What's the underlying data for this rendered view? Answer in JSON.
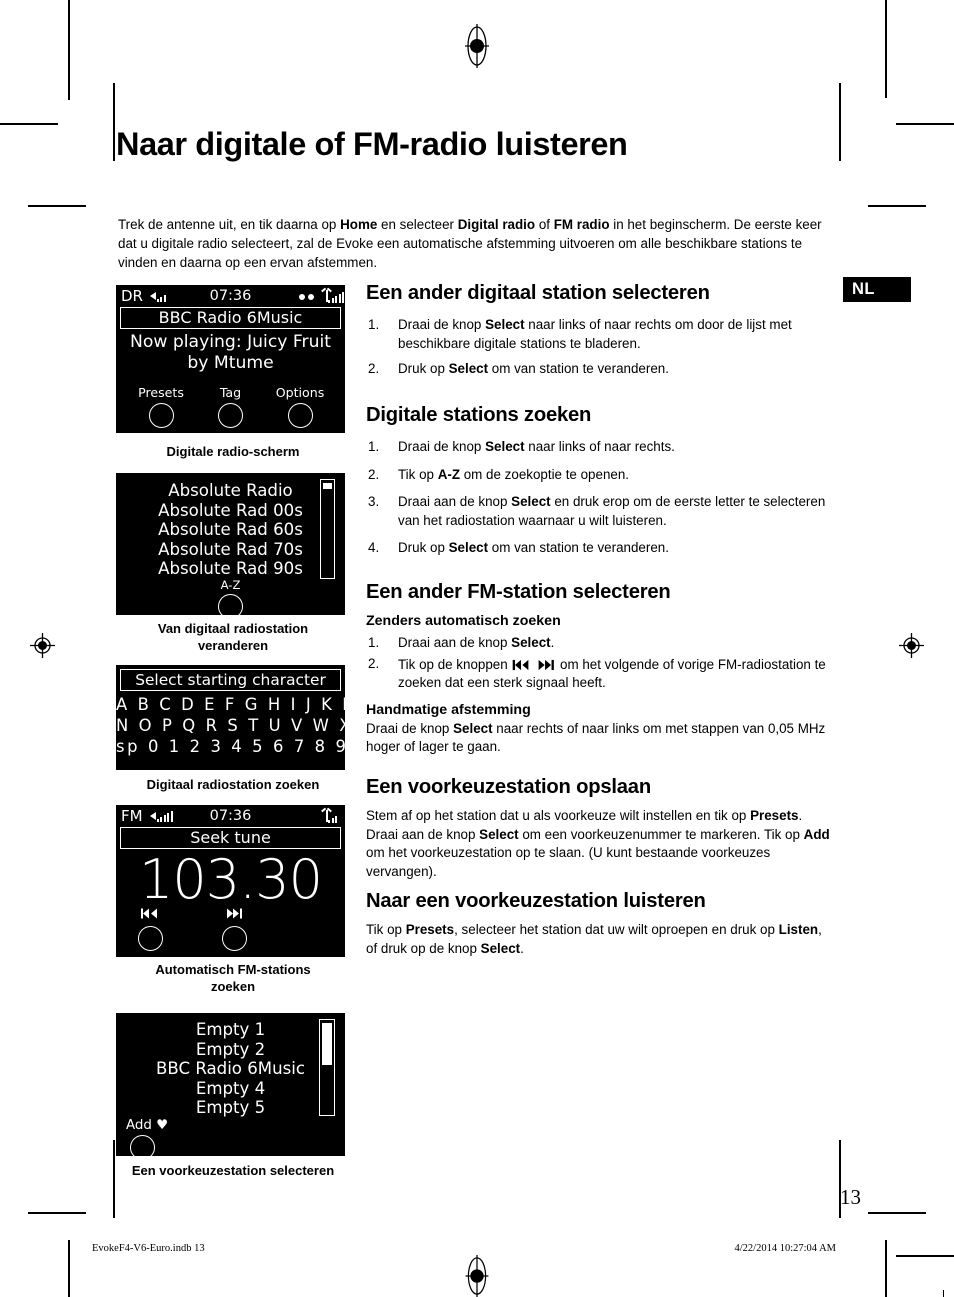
{
  "page": {
    "title": "Naar digitale of FM-radio luisteren",
    "language_badge": "NL",
    "folio": "13",
    "footer_left": "EvokeF4-V6-Euro.indb   13",
    "footer_right": "4/22/2014   10:27:04 AM"
  },
  "intro": {
    "part1": "Trek de antenne uit, en tik daarna op ",
    "b1": "Home",
    "part2": " en selecteer ",
    "b2": "Digital radio",
    "part3": " of ",
    "b3": "FM radio",
    "part4": " in het beginscherm. De eerste keer dat u digitale radio selecteert, zal de Evoke een automatische afstemming uitvoeren om alle beschikbare stations te vinden en daarna op een ervan afstemmen."
  },
  "screens": {
    "digital_radio": {
      "caption": "Digitale radio-scherm",
      "status": {
        "mode": "DR",
        "time": "07:36",
        "volume_icon": "volume-icon",
        "dots_icon": "stereo-dots-icon",
        "signal_icon": "antenna-signal-icon"
      },
      "station": "BBC Radio 6Music",
      "now_playing_line1": "Now playing: Juicy Fruit",
      "now_playing_line2": "by Mtume",
      "softkeys": [
        "Presets",
        "Tag",
        "Options"
      ]
    },
    "station_list": {
      "caption_line1": "Van digitaal radiostation",
      "caption_line2": "veranderen",
      "rows": [
        {
          "label": "Absolute Radio",
          "selected": false
        },
        {
          "label": "Absolute Rad 00s",
          "selected": false
        },
        {
          "label": "Absolute Rad 60s",
          "selected": true
        },
        {
          "label": "Absolute Rad 70s",
          "selected": false
        },
        {
          "label": "Absolute Rad 90s",
          "selected": false
        }
      ],
      "softkey": "A-Z"
    },
    "keyboard": {
      "caption": "Digitaal radiostation zoeken",
      "banner": "Select starting character",
      "rows": [
        "A B C D E F G H I J K L M",
        "N O P Q R S T U V W X Y Z",
        "sp 0 1 2 3 4 5 6 7 8 9"
      ]
    },
    "fm": {
      "caption_line1": "Automatisch FM-stations",
      "caption_line2": "zoeken",
      "status": {
        "mode": "FM",
        "time": "07:36"
      },
      "banner": "Seek tune",
      "frequency": "103.30",
      "keys": [
        "prev-track-icon",
        "next-track-icon"
      ]
    },
    "presets": {
      "caption": "Een voorkeuzestation selecteren",
      "rows": [
        {
          "label": "Empty 1",
          "selected": false
        },
        {
          "label": "Empty 2",
          "selected": false
        },
        {
          "label": "BBC Radio 6Music",
          "selected": true
        },
        {
          "label": "Empty 4",
          "selected": false
        },
        {
          "label": "Empty 5",
          "selected": false
        }
      ],
      "softkey": "Add ♥"
    }
  },
  "sections": {
    "digital_select": {
      "heading": "Een ander digitaal station selecteren",
      "steps": [
        {
          "num": "1.",
          "pre": "Draai de knop ",
          "b": "Select",
          "post": " naar links of naar rechts om door de lijst met beschikbare digitale stations te bladeren."
        },
        {
          "num": "2.",
          "pre": "Druk op ",
          "b": "Select",
          "post": " om van station te veranderen."
        }
      ]
    },
    "digital_search": {
      "heading": "Digitale stations zoeken",
      "steps": [
        {
          "num": "1.",
          "pre": "Draai de knop ",
          "b": "Select",
          "post": " naar links of naar rechts."
        },
        {
          "num": "2.",
          "pre": "Tik op ",
          "b": "A-Z",
          "post": " om de zoekoptie te openen."
        },
        {
          "num": "3.",
          "pre": "Draai aan de knop ",
          "b": "Select",
          "post": " en druk erop om de eerste letter te selecteren van het radiostation waarnaar u wilt luisteren."
        },
        {
          "num": "4.",
          "pre": "Druk op ",
          "b": "Select",
          "post": " om van station te veranderen."
        }
      ]
    },
    "fm_select": {
      "heading": "Een ander FM-station selecteren",
      "sub_auto": "Zenders automatisch zoeken",
      "auto_steps": [
        {
          "num": "1.",
          "pre": "Draai aan de knop ",
          "b": "Select",
          "post": "."
        }
      ],
      "step2_num": "2.",
      "step2_pre": "Tik op de knoppen ",
      "step2_glyphs": "⏮ ⏭",
      "step2_post": " om het volgende of vorige FM-radiostation te zoeken dat een sterk signaal heeft.",
      "sub_manual": "Handmatige afstemming",
      "manual_pre": "Draai de knop ",
      "manual_b": "Select",
      "manual_post": " naar rechts of naar links om met stappen van 0,05 MHz hoger of lager te gaan."
    },
    "preset_save": {
      "heading": "Een voorkeuzestation opslaan",
      "p1": "Stem af op het station dat u als voorkeuze wilt instellen en tik op ",
      "b1": "Presets",
      "p2": ". Draai aan de knop ",
      "b2": "Select",
      "p3": " om een voorkeuzenummer te markeren. Tik op ",
      "b3": "Add",
      "p4": " om het voorkeuzestation op te slaan. (U kunt bestaande voorkeuzes vervangen)."
    },
    "preset_listen": {
      "heading": "Naar een voorkeuzestation luisteren",
      "p1": "Tik op ",
      "b1": "Presets",
      "p2": ", selecteer het station dat uw wilt oproepen en druk op ",
      "b2": "Listen",
      "p3": ", of druk op de knop ",
      "b3": "Select",
      "p4": "."
    }
  }
}
